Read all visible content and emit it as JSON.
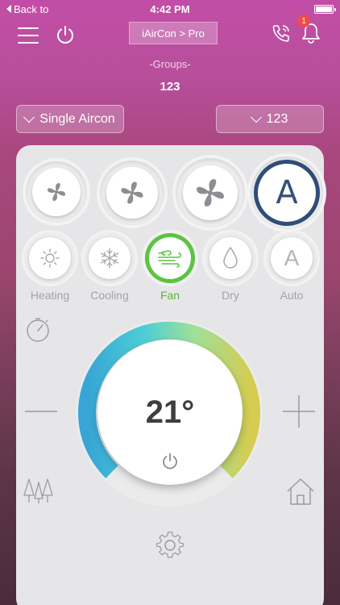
{
  "status_bar": {
    "back_label": "Back to",
    "time": "4:42 PM"
  },
  "header": {
    "title": "iAirCon > Pro",
    "notification_count": "1"
  },
  "groups": {
    "label": "-Groups-",
    "value": "123"
  },
  "dropdowns": {
    "aircon_select": "Single Aircon",
    "group_select": "123"
  },
  "fan_speeds": [
    {
      "name": "fan-low",
      "icon": "fan-small-icon"
    },
    {
      "name": "fan-medium",
      "icon": "fan-medium-icon"
    },
    {
      "name": "fan-high",
      "icon": "fan-large-icon"
    },
    {
      "name": "fan-auto",
      "label": "A",
      "selected": true
    }
  ],
  "modes": {
    "heating": {
      "label": "Heating",
      "icon": "sun-icon"
    },
    "cooling": {
      "label": "Cooling",
      "icon": "snowflake-icon"
    },
    "fan": {
      "label": "Fan",
      "icon": "wind-icon",
      "selected": true
    },
    "dry": {
      "label": "Dry",
      "icon": "droplet-icon"
    },
    "auto": {
      "label": "Auto",
      "letter": "A"
    }
  },
  "thermostat": {
    "temperature": "21°"
  },
  "colors": {
    "accent_fan_auto": "#34507a",
    "accent_mode_active": "#5cc43f",
    "dial_gradient": [
      "#37a5d6",
      "#4dcfd5",
      "#9fe09a",
      "#d8d264",
      "#c8c040"
    ]
  }
}
